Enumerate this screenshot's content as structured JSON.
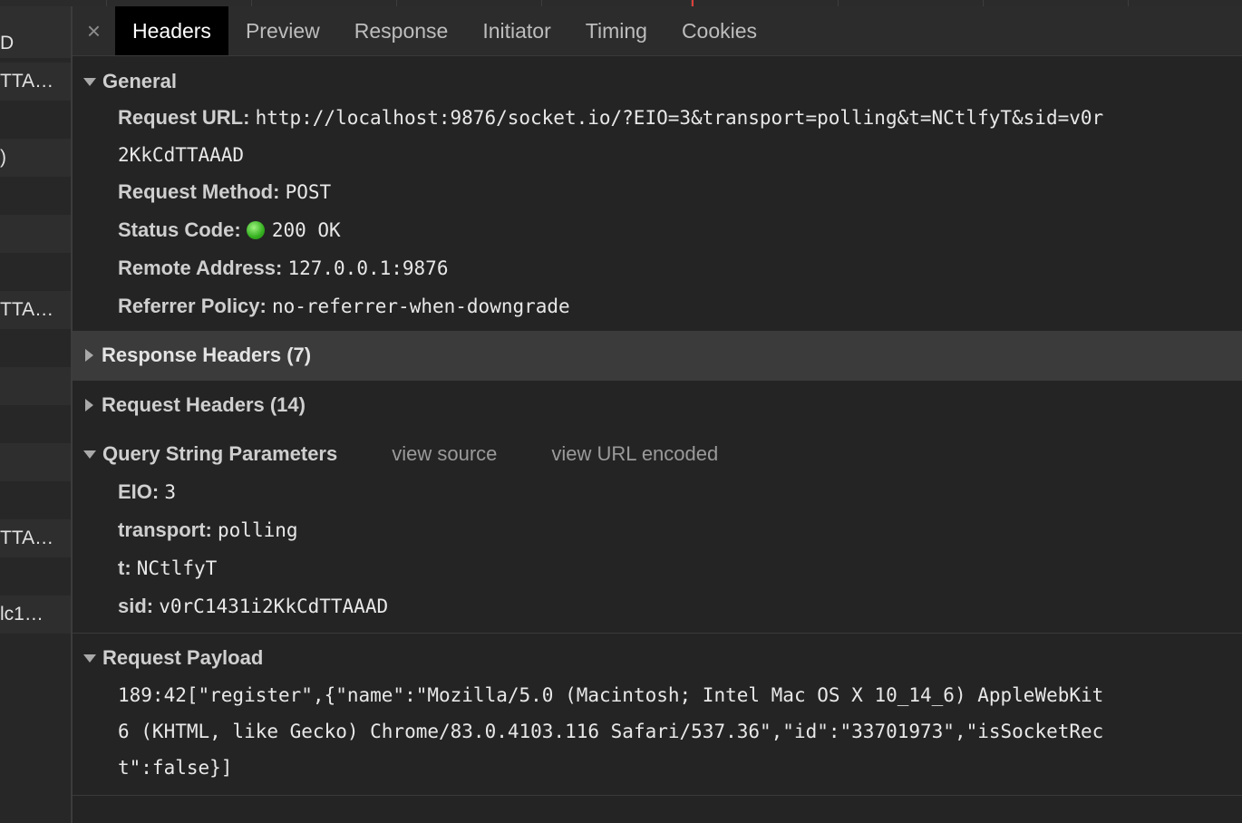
{
  "tabs": [
    "Headers",
    "Preview",
    "Response",
    "Initiator",
    "Timing",
    "Cookies"
  ],
  "left_list": [
    "D",
    "TTA…",
    "",
    ")",
    "",
    "",
    "",
    "TTA…",
    "",
    "",
    "",
    "",
    "",
    "TTA…",
    "",
    "lc1…",
    ""
  ],
  "general": {
    "title": "General",
    "request_url_label": "Request URL:",
    "request_url_line1": "http://localhost:9876/socket.io/?EIO=3&transport=polling&t=NCtlfyT&sid=v0r",
    "request_url_line2": "2KkCdTTAAAD",
    "request_method_label": "Request Method:",
    "request_method": "POST",
    "status_code_label": "Status Code:",
    "status_code": "200 OK",
    "status_color": "#34b01f",
    "remote_address_label": "Remote Address:",
    "remote_address": "127.0.0.1:9876",
    "referrer_policy_label": "Referrer Policy:",
    "referrer_policy": "no-referrer-when-downgrade"
  },
  "response_headers": "Response Headers (7)",
  "request_headers": "Request Headers (14)",
  "query": {
    "title": "Query String Parameters",
    "view_source": "view source",
    "view_url_encoded": "view URL encoded",
    "params": [
      {
        "key": "EIO:",
        "value": "3"
      },
      {
        "key": "transport:",
        "value": "polling"
      },
      {
        "key": "t:",
        "value": "NCtlfyT"
      },
      {
        "key": "sid:",
        "value": "v0rC1431i2KkCdTTAAAD"
      }
    ]
  },
  "payload": {
    "title": "Request Payload",
    "line1": "189:42[\"register\",{\"name\":\"Mozilla/5.0 (Macintosh; Intel Mac OS X 10_14_6) AppleWebKit",
    "line2": "6 (KHTML, like Gecko) Chrome/83.0.4103.116 Safari/537.36\",\"id\":\"33701973\",\"isSocketRec",
    "line3": "t\":false}]"
  }
}
